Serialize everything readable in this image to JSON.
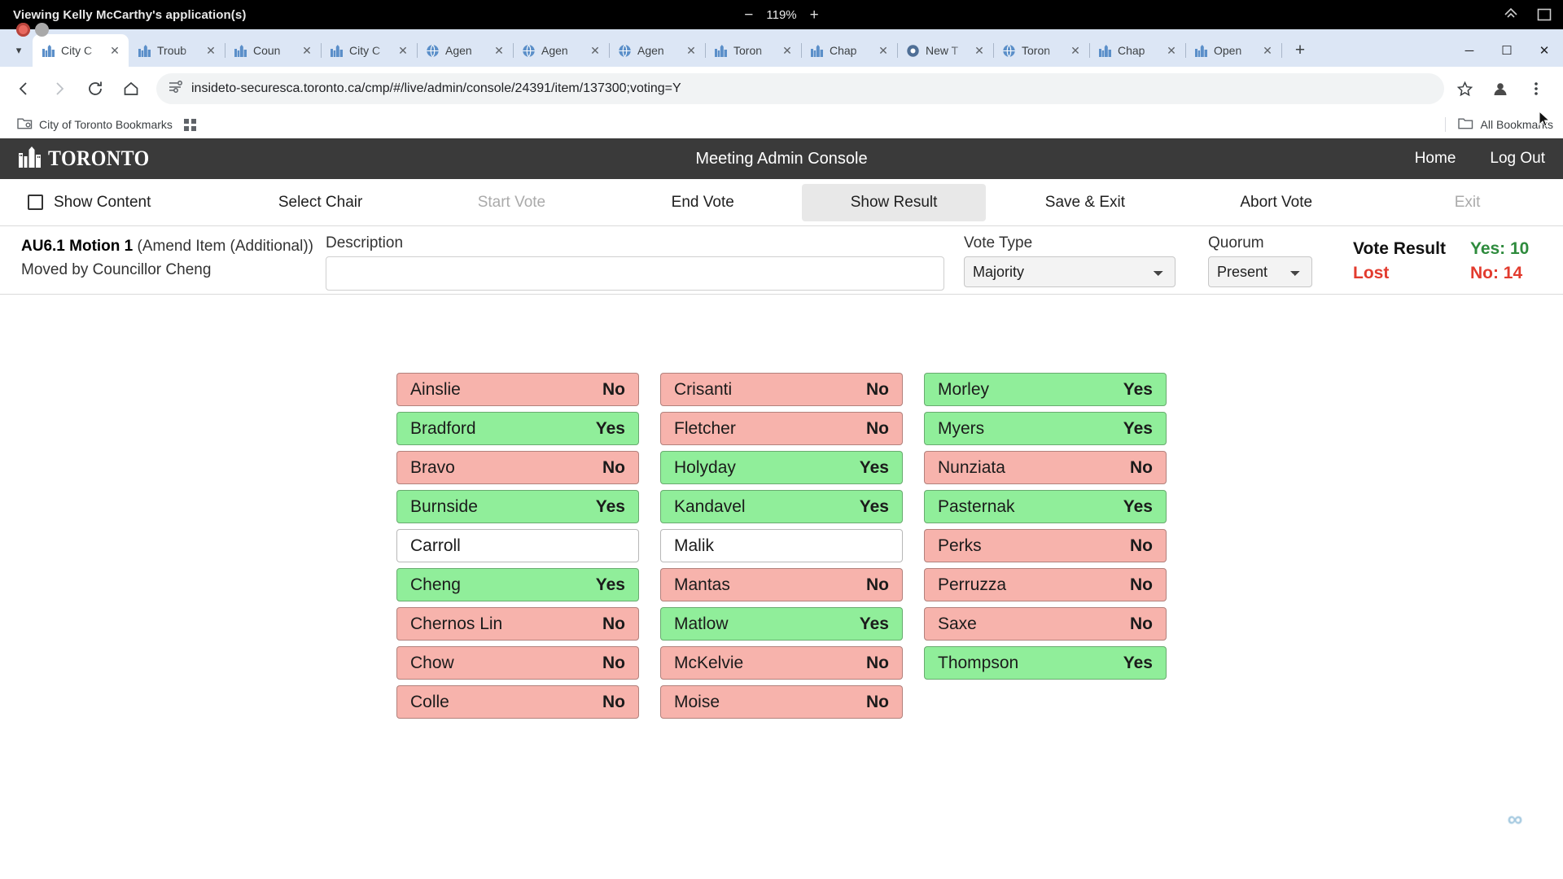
{
  "os_bar": {
    "title": "Viewing Kelly McCarthy's application(s)",
    "zoom_out": "−",
    "zoom_level": "119%",
    "zoom_in": "+"
  },
  "browser": {
    "tabs": [
      {
        "label": "City C",
        "favicon": "toronto-icon",
        "active": true
      },
      {
        "label": "Troub",
        "favicon": "toronto-icon",
        "active": false
      },
      {
        "label": "Coun",
        "favicon": "toronto-icon",
        "active": false
      },
      {
        "label": "City C",
        "favicon": "toronto-icon",
        "active": false
      },
      {
        "label": "Agen",
        "favicon": "globe-icon",
        "active": false
      },
      {
        "label": "Agen",
        "favicon": "globe-icon",
        "active": false
      },
      {
        "label": "Agen",
        "favicon": "globe-icon",
        "active": false
      },
      {
        "label": "Toron",
        "favicon": "toronto-icon",
        "active": false
      },
      {
        "label": "Chap",
        "favicon": "toronto-icon",
        "active": false
      },
      {
        "label": "New T",
        "favicon": "chrome-icon",
        "active": false
      },
      {
        "label": "Toron",
        "favicon": "globe-icon",
        "active": false
      },
      {
        "label": "Chap",
        "favicon": "toronto-icon",
        "active": false
      },
      {
        "label": "Open",
        "favicon": "toronto-icon",
        "active": false
      }
    ],
    "new_tab_label": "+",
    "window_controls": {
      "minimize": "─",
      "maximize": "☐",
      "close": "✕"
    },
    "url": "insideto-securesca.toronto.ca/cmp/#/live/admin/console/24391/item/137300;voting=Y",
    "bookmarks": {
      "folder_label": "City of Toronto Bookmarks",
      "all_bookmarks_label": "All Bookmarks"
    }
  },
  "app_header": {
    "logo_text": "TORONTO",
    "title": "Meeting Admin Console",
    "home_label": "Home",
    "logout_label": "Log Out"
  },
  "action_bar": {
    "items": [
      {
        "label": "Show Content",
        "state": "checkbox"
      },
      {
        "label": "Select Chair",
        "state": "enabled"
      },
      {
        "label": "Start Vote",
        "state": "disabled"
      },
      {
        "label": "End Vote",
        "state": "enabled"
      },
      {
        "label": "Show Result",
        "state": "selected"
      },
      {
        "label": "Save & Exit",
        "state": "enabled"
      },
      {
        "label": "Abort Vote",
        "state": "enabled"
      },
      {
        "label": "Exit",
        "state": "disabled"
      }
    ]
  },
  "motion": {
    "item_code": "AU6.1 Motion 1",
    "item_kind": "(Amend Item (Additional))",
    "moved_by": "Moved by Councillor Cheng",
    "description_label": "Description",
    "description_value": "",
    "description_placeholder": "",
    "vote_type_label": "Vote Type",
    "vote_type_value": "Majority",
    "vote_type_options": [
      "Majority"
    ],
    "quorum_label": "Quorum",
    "quorum_value": "Present",
    "quorum_options": [
      "Present"
    ],
    "vote_result_label": "Vote Result",
    "vote_result_value": "Lost",
    "yes_count_label": "Yes: 10",
    "no_count_label": "No: 14"
  },
  "votes": {
    "columns": [
      [
        {
          "name": "Ainslie",
          "vote": "No",
          "state": "no"
        },
        {
          "name": "Bradford",
          "vote": "Yes",
          "state": "yes"
        },
        {
          "name": "Bravo",
          "vote": "No",
          "state": "no"
        },
        {
          "name": "Burnside",
          "vote": "Yes",
          "state": "yes"
        },
        {
          "name": "Carroll",
          "vote": "",
          "state": "none"
        },
        {
          "name": "Cheng",
          "vote": "Yes",
          "state": "yes"
        },
        {
          "name": "Chernos Lin",
          "vote": "No",
          "state": "no"
        },
        {
          "name": "Chow",
          "vote": "No",
          "state": "no"
        },
        {
          "name": "Colle",
          "vote": "No",
          "state": "no"
        }
      ],
      [
        {
          "name": "Crisanti",
          "vote": "No",
          "state": "no"
        },
        {
          "name": "Fletcher",
          "vote": "No",
          "state": "no"
        },
        {
          "name": "Holyday",
          "vote": "Yes",
          "state": "yes"
        },
        {
          "name": "Kandavel",
          "vote": "Yes",
          "state": "yes"
        },
        {
          "name": "Malik",
          "vote": "",
          "state": "none"
        },
        {
          "name": "Mantas",
          "vote": "No",
          "state": "no"
        },
        {
          "name": "Matlow",
          "vote": "Yes",
          "state": "yes"
        },
        {
          "name": "McKelvie",
          "vote": "No",
          "state": "no"
        },
        {
          "name": "Moise",
          "vote": "No",
          "state": "no"
        }
      ],
      [
        {
          "name": "Morley",
          "vote": "Yes",
          "state": "yes"
        },
        {
          "name": "Myers",
          "vote": "Yes",
          "state": "yes"
        },
        {
          "name": "Nunziata",
          "vote": "No",
          "state": "no"
        },
        {
          "name": "Pasternak",
          "vote": "Yes",
          "state": "yes"
        },
        {
          "name": "Perks",
          "vote": "No",
          "state": "no"
        },
        {
          "name": "Perruzza",
          "vote": "No",
          "state": "no"
        },
        {
          "name": "Saxe",
          "vote": "No",
          "state": "no"
        },
        {
          "name": "Thompson",
          "vote": "Yes",
          "state": "yes"
        }
      ]
    ]
  },
  "colors": {
    "yes_bg": "#90ee9a",
    "no_bg": "#f7b3ac",
    "none_bg": "#ffffff",
    "header_bg": "#3a3a3a",
    "yes_text": "#2e8b3d",
    "no_text": "#e23b2e"
  }
}
